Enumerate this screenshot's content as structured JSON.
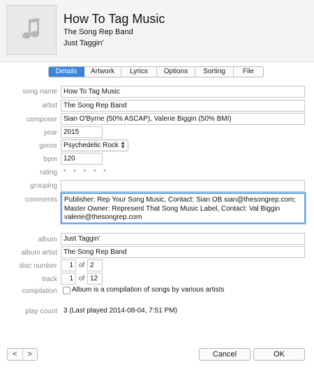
{
  "track": {
    "title": "How To Tag Music",
    "artist": "The Song Rep Band",
    "album": "Just Taggin'"
  },
  "tabs": [
    {
      "label": "Details"
    },
    {
      "label": "Artwork"
    },
    {
      "label": "Lyrics"
    },
    {
      "label": "Options"
    },
    {
      "label": "Sorting"
    },
    {
      "label": "File"
    }
  ],
  "labels": {
    "song_name": "song name",
    "artist": "artist",
    "composer": "composer",
    "year": "year",
    "genre": "genre",
    "bpm": "bpm",
    "rating": "rating",
    "grouping": "grouping",
    "comments": "comments",
    "album": "album",
    "album_artist": "album artist",
    "disc_number": "disc number",
    "track": "track",
    "compilation": "compilation",
    "play_count": "play count",
    "of": "of"
  },
  "fields": {
    "song_name": "How To Tag Music",
    "artist": "The Song Rep Band",
    "composer": "Sian O'Byrne (50% ASCAP), Valerie Biggin (50% BMI)",
    "year": "2015",
    "genre": "Psychedelic Rock",
    "bpm": "120",
    "rating": "• • • • •",
    "grouping": "",
    "comments": "Publisher: Rep Your Song Music, Contact: Sian OB sian@thesongrep.com; Master Owner: Represent That Song Music Label, Contact: Val Biggin valerie@thesongrep.com",
    "album": "Just Taggin'",
    "album_artist": "The Song Rep Band",
    "disc_number": "1",
    "disc_total": "2",
    "track_number": "1",
    "track_total": "12",
    "compilation_label": "Album is a compilation of songs by various artists",
    "compilation_checked": false,
    "play_count": "3 (Last played 2014-08-04, 7:51 PM)"
  },
  "footer": {
    "prev": "<",
    "next": ">",
    "cancel": "Cancel",
    "ok": "OK"
  },
  "icons": {
    "artwork": "music-note-icon",
    "genre_select": "chevron-updown-icon"
  },
  "colors": {
    "accent": "#3b86dc",
    "focus_ring": "#6aa1e4"
  }
}
